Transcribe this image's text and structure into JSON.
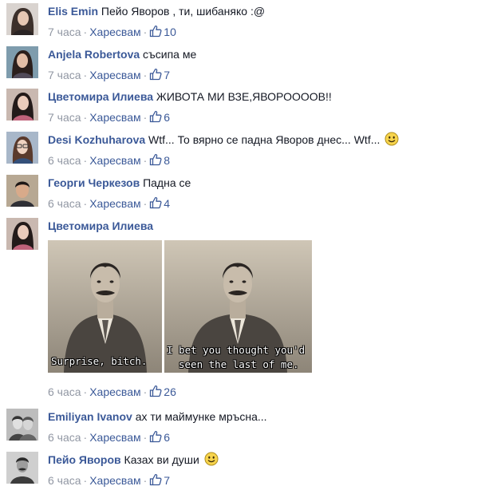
{
  "ui": {
    "like_label": "Харесвам",
    "dot": "·"
  },
  "comments": [
    {
      "author": "Elis Emin",
      "text": " Пейо Яворов , ти, шибаняко :@",
      "time": "7 часа",
      "likes": "10",
      "avatar": "woman-long-dark-hair"
    },
    {
      "author": "Anjela Robertova",
      "text": " съсипа ме",
      "time": "7 часа",
      "likes": "7",
      "avatar": "woman-dark-hair"
    },
    {
      "author": "Цветомира Илиева",
      "text": " ЖИВОТА МИ ВЗЕ,ЯВОРООООВ!!",
      "time": "7 часа",
      "likes": "6",
      "avatar": "woman-dark-hair-pink"
    },
    {
      "author": "Desi Kozhuharova",
      "text": " Wtf... То вярно се падна Яворов днес... Wtf...",
      "time": "6 часа",
      "likes": "8",
      "avatar": "woman-glasses",
      "emoji": "smile"
    },
    {
      "author": "Георги Черкезов",
      "text": " Падна се",
      "time": "6 часа",
      "likes": "4",
      "avatar": "man-dark-hair"
    },
    {
      "author": "Цветомира Илиева",
      "text": "",
      "time": "6 часа",
      "likes": "26",
      "avatar": "woman-dark-hair-pink",
      "meme": {
        "caption_left": "Surprise, bitch.",
        "caption_right_1": "I bet you thought you'd",
        "caption_right_2": "seen the last of me."
      }
    },
    {
      "author": "Emiliyan Ivanov",
      "text": " ах ти маймунке мръсна...",
      "time": "6 часа",
      "likes": "6",
      "avatar": "couple-bw"
    },
    {
      "author": "Пейо Яворов",
      "text": " Казах ви души",
      "time": "6 часа",
      "likes": "7",
      "avatar": "man-bw-portrait",
      "emoji": "smile"
    }
  ]
}
